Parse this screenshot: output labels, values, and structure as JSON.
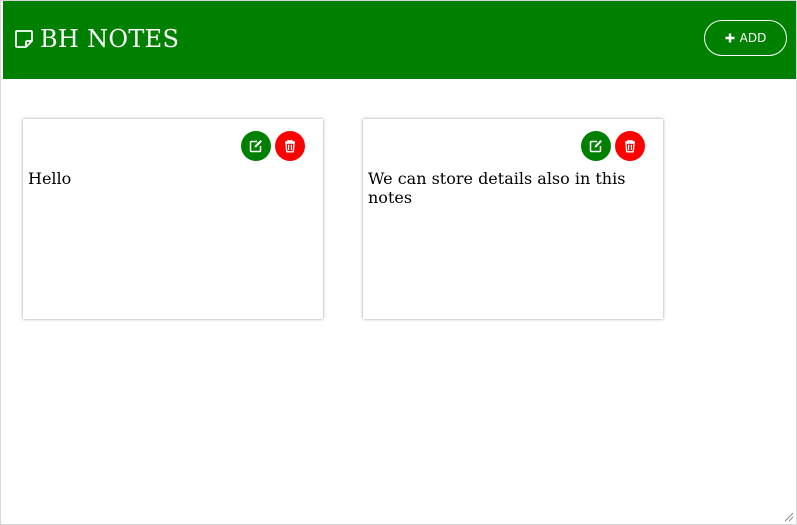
{
  "colors": {
    "header_bg": "#008000",
    "edit": "#008000",
    "delete": "#ff0000",
    "text": "#000000"
  },
  "header": {
    "title": "BH NOTES",
    "logo_icon": "sticky-note-icon",
    "add_label": "ADD",
    "add_icon": "plus-icon"
  },
  "notes": [
    {
      "text": "Hello",
      "edit_icon": "edit-icon",
      "delete_icon": "trash-icon"
    },
    {
      "text": "We can store details also in this notes",
      "edit_icon": "edit-icon",
      "delete_icon": "trash-icon"
    }
  ]
}
